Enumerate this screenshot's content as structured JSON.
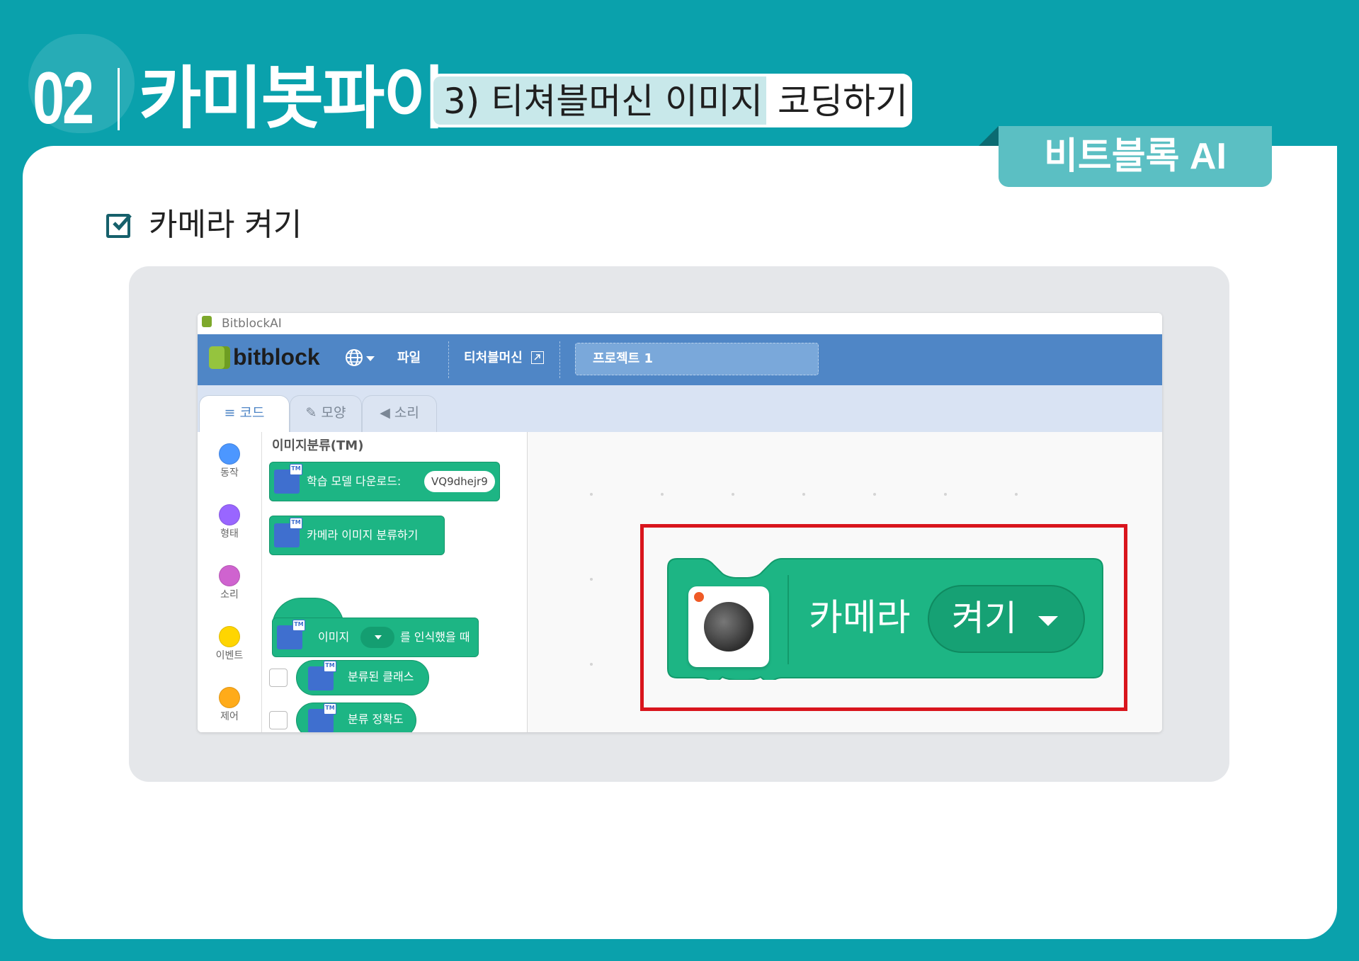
{
  "header": {
    "lesson_number": "02",
    "lesson_title": "카미봇파이",
    "subtitle_part1": "3) 티쳐블머신 이미지",
    "subtitle_part2": "코딩하기",
    "badge": "비트블록 AI"
  },
  "section": {
    "title": "카메라 켜기"
  },
  "app": {
    "window_title": "BitblockAI",
    "logo_text": "bitblock",
    "menu": {
      "file": "파일",
      "teachable_machine": "티처블머신",
      "project_name": "프로젝트 1"
    },
    "tabs": [
      {
        "label": "코드"
      },
      {
        "label": "모양"
      },
      {
        "label": "소리"
      }
    ],
    "categories": [
      {
        "label": "동작",
        "color": "#4c97ff"
      },
      {
        "label": "형태",
        "color": "#9966ff"
      },
      {
        "label": "소리",
        "color": "#cf63cf"
      },
      {
        "label": "이벤트",
        "color": "#ffd500"
      },
      {
        "label": "제어",
        "color": "#ffab19"
      }
    ],
    "palette": {
      "heading": "이미지분류(TM)",
      "blocks": {
        "download_label": "학습 모델 다운로드:",
        "download_value": "VQ9dhejr9",
        "classify_label": "카메라 이미지 분류하기",
        "hat_label_a": "이미지",
        "hat_label_b": "를 인식했을 때",
        "reporter_class": "분류된 클래스",
        "reporter_accuracy": "분류 정확도"
      }
    },
    "workspace": {
      "block_label": "카메라",
      "block_dropdown": "켜기"
    }
  }
}
